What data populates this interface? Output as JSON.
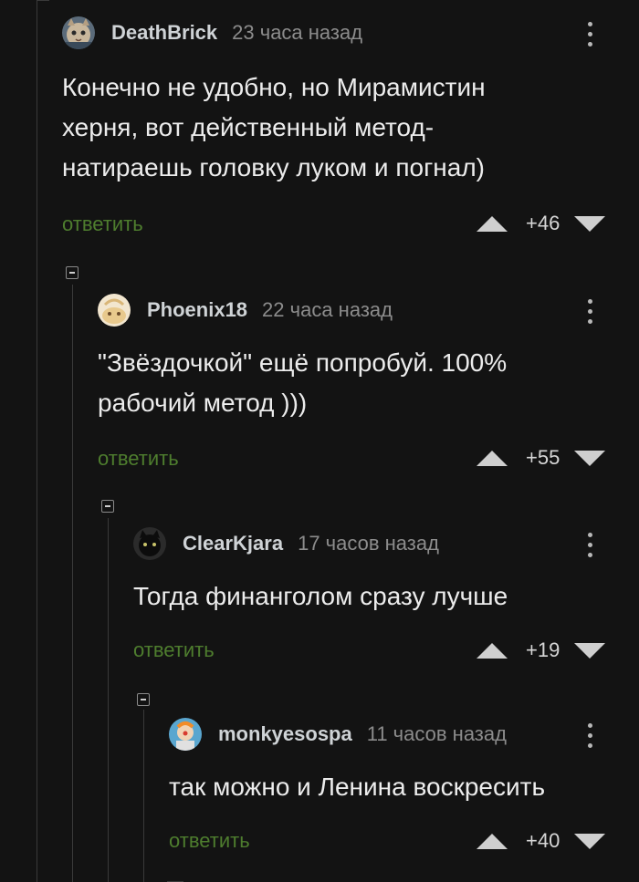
{
  "comments": [
    {
      "author": "DeathBrick",
      "time": "23 часа назад",
      "text": "Конечно не удобно, но Мирамистин\nхерня, вот действенный метод-\nнатираешь головку луком и погнал)",
      "reply_label": "ответить",
      "rating": "+46",
      "avatar_icon": "cat-avatar-icon"
    },
    {
      "author": "Phoenix18",
      "time": "22 часа назад",
      "text": "\"Звёздочкой\" ещё попробуй. 100%\nрабочий метод )))",
      "reply_label": "ответить",
      "rating": "+55",
      "avatar_icon": "cartoon-avatar-icon"
    },
    {
      "author": "ClearKjara",
      "time": "17 часов назад",
      "text": "Тогда финанголом сразу лучше",
      "reply_label": "ответить",
      "rating": "+19",
      "avatar_icon": "black-cat-avatar-icon"
    },
    {
      "author": "monkyesospa",
      "time": "11 часов назад",
      "text": "так можно и Ленина воскресить",
      "reply_label": "ответить",
      "rating": "+40",
      "avatar_icon": "clown-avatar-icon"
    }
  ],
  "colors": {
    "background": "#131313",
    "reply_link": "#4e7d2e",
    "author": "#cfd3d6",
    "timestamp": "#8c8c8c"
  }
}
